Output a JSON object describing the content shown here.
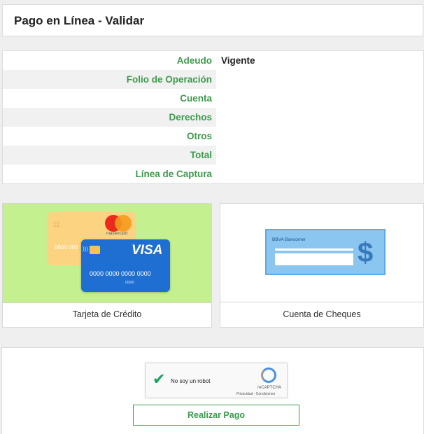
{
  "header": {
    "title": "Pago en Línea - Validar"
  },
  "details": {
    "rows": [
      {
        "label": "Adeudo",
        "value": "Vigente"
      },
      {
        "label": "Folio de Operación",
        "value": ""
      },
      {
        "label": "Cuenta",
        "value": ""
      },
      {
        "label": "Derechos",
        "value": ""
      },
      {
        "label": "Otros",
        "value": ""
      },
      {
        "label": "Total",
        "value": ""
      },
      {
        "label": "Línea de Captura",
        "value": ""
      }
    ]
  },
  "payment_options": {
    "credit_card": {
      "label": "Tarjeta de Crédito",
      "mastercard_text": "mastercard",
      "mastercard_number": "0000 000",
      "visa_text": "VISA",
      "visa_number": "0000 0000 0000 0000",
      "visa_small": "00/00"
    },
    "cheques": {
      "label": "Cuenta de Cheques",
      "bank_text": "BBVA Bancomer",
      "dollar_symbol": "$"
    }
  },
  "captcha": {
    "label": "No soy un robot",
    "brand": "reCAPTCHA",
    "links": "Privacidad - Condiciones"
  },
  "actions": {
    "pay_button": "Realizar Pago"
  },
  "colors": {
    "accent": "#3e9a4c",
    "credit_bg": "#c5f08f",
    "cheque_bg": "#8bc6f1"
  }
}
